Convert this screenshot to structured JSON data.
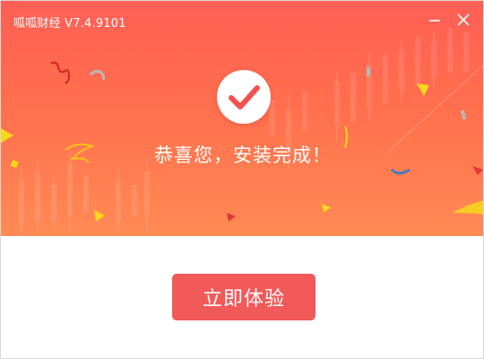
{
  "window": {
    "title": "呱呱财经 V7.4.9101",
    "minimize_icon": "minimize-icon",
    "close_icon": "close-icon"
  },
  "banner": {
    "success_icon": "checkmark-icon",
    "message": "恭喜您，安装完成！"
  },
  "actions": {
    "start_label": "立即体验"
  },
  "colors": {
    "banner_top": "#ff5f55",
    "banner_bottom": "#ff8a55",
    "check_color": "#f0524f",
    "button": "#f25a59",
    "text_on_banner": "#ffffff"
  }
}
